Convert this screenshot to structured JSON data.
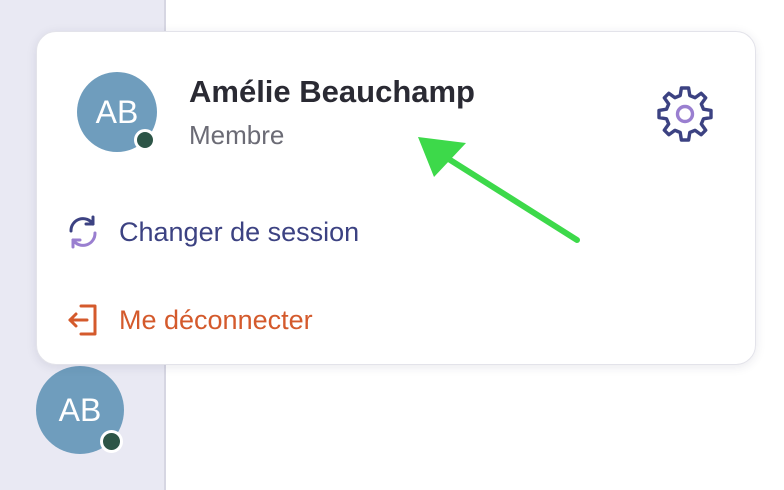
{
  "profile": {
    "initials": "AB",
    "name": "Amélie Beauchamp",
    "role": "Membre",
    "status_color": "#2d5547",
    "avatar_color": "#6f9dbd"
  },
  "menu": {
    "switch_session_label": "Changer de session",
    "logout_label": "Me déconnecter"
  },
  "sidebar": {
    "avatar_initials": "AB"
  },
  "icons": {
    "settings": "gear-icon",
    "switch_session": "refresh-icon",
    "logout": "logout-icon"
  },
  "colors": {
    "accent": "#3c4282",
    "danger": "#d45a2c",
    "annotation": "#3dd94a"
  }
}
